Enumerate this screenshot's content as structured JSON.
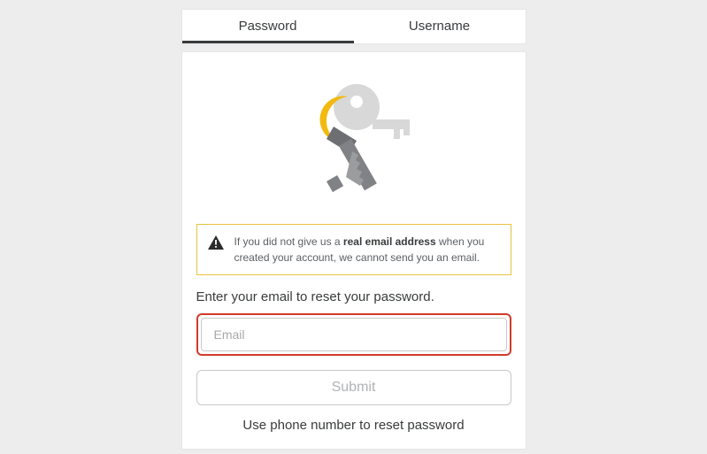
{
  "tabs": {
    "password": "Password",
    "username": "Username"
  },
  "alert": {
    "prefix": "If you did not give us a ",
    "strong": "real email address",
    "suffix": " when you created your account, we cannot send you an email."
  },
  "prompt": "Enter your email to reset your password.",
  "email": {
    "placeholder": "Email"
  },
  "submit": "Submit",
  "phone_link": "Use phone number to reset password"
}
